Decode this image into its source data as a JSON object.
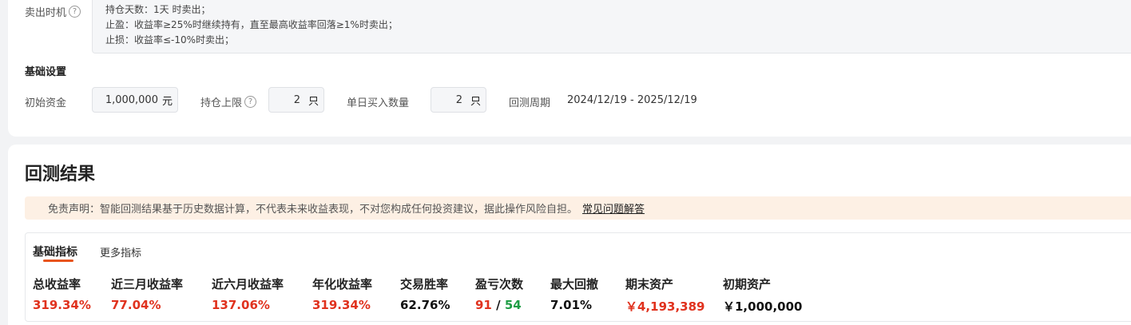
{
  "sell_timing": {
    "label": "卖出时机",
    "help": "?",
    "rules": [
      "持仓天数：1天 时卖出；",
      "止盈：收益率≥25%时继续持有，直至最高收益率回落≥1%时卖出；",
      "止损：收益率≤-10%时卖出；"
    ]
  },
  "basic_settings": {
    "title": "基础设置",
    "initial_capital": {
      "label": "初始资金",
      "value": "1,000,000",
      "unit": "元"
    },
    "position_limit": {
      "label": "持仓上限",
      "help": "?",
      "value": "2",
      "unit": "只"
    },
    "daily_buy": {
      "label": "单日买入数量",
      "value": "2",
      "unit": "只"
    },
    "backtest_period": {
      "label": "回测周期",
      "value": "2024/12/19 - 2025/12/19"
    }
  },
  "results": {
    "title": "回测结果",
    "disclaimer": "免责声明：智能回测结果基于历史数据计算，不代表未来收益表现，不对您构成任何投资建议，据此操作风险自担。",
    "faq_link": "常见问题解答",
    "tabs": [
      "基础指标",
      "更多指标"
    ],
    "metrics": [
      {
        "label": "总收益率",
        "value": "319.34%"
      },
      {
        "label": "近三月收益率",
        "value": "77.04%"
      },
      {
        "label": "近六月收益率",
        "value": "137.06%"
      },
      {
        "label": "年化收益率",
        "value": "319.34%"
      },
      {
        "label": "交易胜率",
        "value": "62.76%"
      },
      {
        "label": "盈亏次数",
        "win": "91",
        "sep": "/",
        "loss": "54"
      },
      {
        "label": "最大回撤",
        "value": "7.01%"
      },
      {
        "label": "期末资产",
        "value": "￥4,193,389"
      },
      {
        "label": "初期资产",
        "value": "￥1,000,000"
      }
    ]
  },
  "colors": {
    "positive": "#e0321e",
    "negative": "#1f9d45",
    "accent": "#e8541d"
  }
}
